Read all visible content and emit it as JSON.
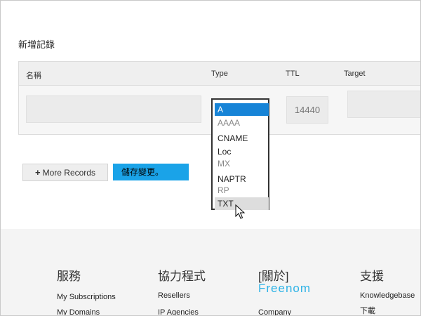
{
  "section": {
    "title": "新增記錄"
  },
  "table": {
    "headers": {
      "name": "名稱",
      "type": "Type",
      "ttl": "TTL",
      "target": "Target"
    },
    "row": {
      "ttl_value": "14440"
    }
  },
  "type_dropdown": {
    "options": [
      {
        "label": "A",
        "state": "selected"
      },
      {
        "label": "AAAA",
        "state": "disabled"
      },
      {
        "label": "CNAME",
        "state": "normal"
      },
      {
        "label": "Loc",
        "state": "normal"
      },
      {
        "label": "MX",
        "state": "disabled"
      },
      {
        "label": "NAPTR",
        "state": "normal"
      },
      {
        "label": "RP",
        "state": "disabled"
      },
      {
        "label": "TXT",
        "state": "hover"
      }
    ]
  },
  "buttons": {
    "more_records": "More Records",
    "save_changes": "儲存變更。"
  },
  "icons": {
    "plus": "plus-icon",
    "cursor": "mouse-pointer-icon"
  },
  "footer": {
    "col1": {
      "heading": "服務",
      "links": [
        "My Subscriptions",
        "My Domains"
      ]
    },
    "col2": {
      "heading": "協力程式",
      "links": [
        "Resellers",
        "IP Agencies"
      ]
    },
    "col3": {
      "heading": "[關於]",
      "brand": "Freenom",
      "links": [
        "Company"
      ]
    },
    "col4": {
      "heading": "支援",
      "links": [
        "Knowledgebase",
        "下載"
      ]
    }
  },
  "colors": {
    "accent": "#1aa3e8",
    "selected_option": "#1784d7",
    "brand": "#2fb3e6"
  }
}
